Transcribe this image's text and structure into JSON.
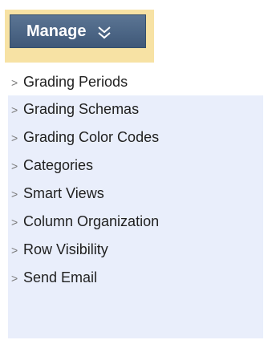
{
  "manage_button": {
    "label": "Manage",
    "icon": "double-chevron-down-icon"
  },
  "menu": {
    "items": [
      {
        "label": "Grading Periods"
      },
      {
        "label": "Grading Schemas"
      },
      {
        "label": "Grading Color Codes"
      },
      {
        "label": "Categories"
      },
      {
        "label": "Smart Views"
      },
      {
        "label": "Column Organization"
      },
      {
        "label": "Row Visibility"
      },
      {
        "label": "Send Email"
      }
    ],
    "arrow_glyph": ">"
  },
  "colors": {
    "button_bg": "#4a6383",
    "highlight": "#f7e2a4",
    "menu_bg": "#e9eefb",
    "first_item_bg": "#ffffff"
  }
}
